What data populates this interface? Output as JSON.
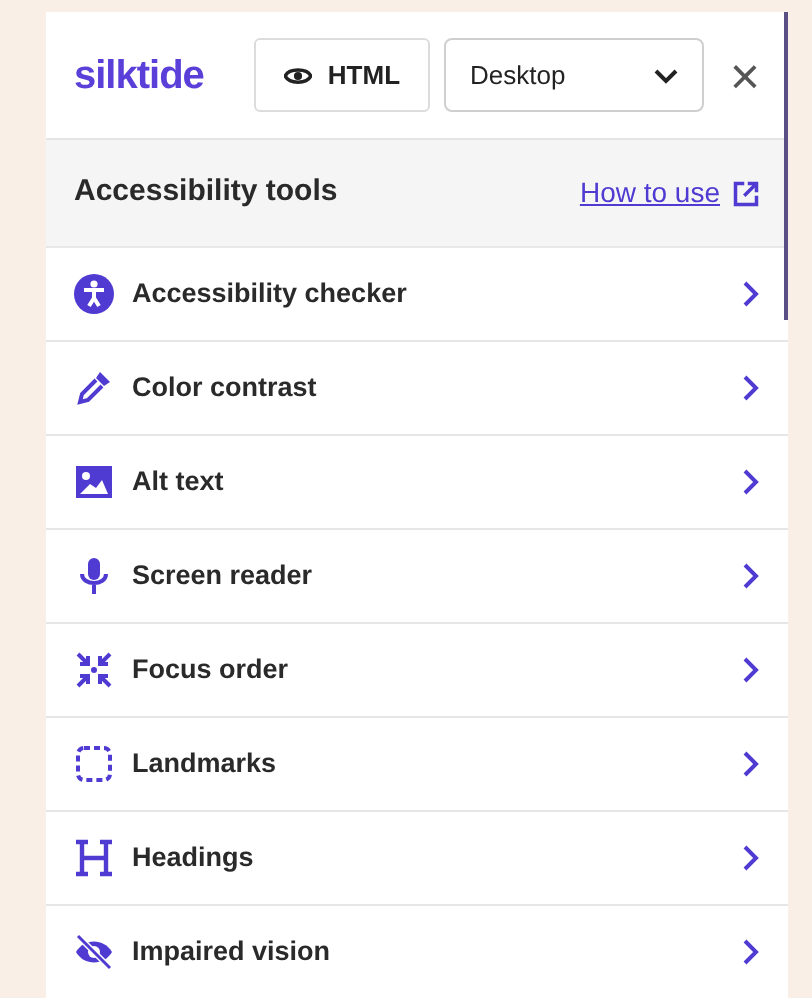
{
  "header": {
    "logo": "silktide",
    "view_button": "HTML",
    "device_select": {
      "value": "Desktop"
    },
    "close": "×"
  },
  "section": {
    "title": "Accessibility tools",
    "link": "How to use"
  },
  "tools": [
    {
      "label": "Accessibility checker",
      "kind": "person"
    },
    {
      "label": "Color contrast",
      "kind": "dropper"
    },
    {
      "label": "Alt text",
      "kind": "image"
    },
    {
      "label": "Screen reader",
      "kind": "mic"
    },
    {
      "label": "Focus order",
      "kind": "focus"
    },
    {
      "label": "Landmarks",
      "kind": "dashed"
    },
    {
      "label": "Headings",
      "kind": "heading"
    },
    {
      "label": "Impaired vision",
      "kind": "eye"
    }
  ]
}
